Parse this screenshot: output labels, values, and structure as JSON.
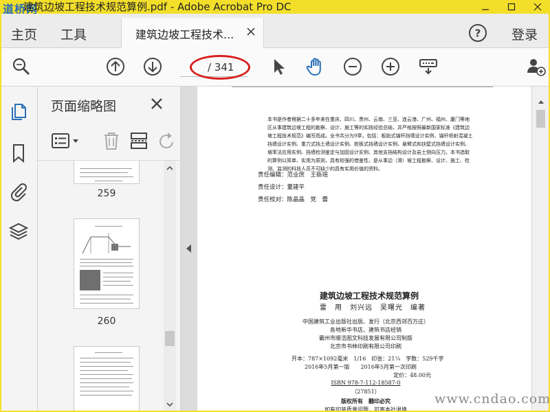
{
  "window": {
    "title": "建筑边坡工程技术规范算例.pdf - Adobe Acrobat Pro DC",
    "logo": "道桥网"
  },
  "nav": {
    "home": "主页",
    "tools": "工具",
    "doc_tab": "建筑边坡工程技术...",
    "login": "登录"
  },
  "toolbar": {
    "page_total": "/ 341"
  },
  "thumbnails_panel": {
    "title": "页面缩略图",
    "pages": [
      {
        "label": "259"
      },
      {
        "label": "260"
      }
    ]
  },
  "document": {
    "intro": "本书是作者根据二十多年来在重庆、四川、贵州、云南、三亚、连云港、广州、福州、厦门等地区从事建筑边坡工程的勘察、设计、施工等的实践经验总结，并严格按照最新国家标准《建筑边坡工程技术规范》编写而成。全书共分为9章，包括：板肋式锚杆挡墙设计实例、锚杆喷射混凝土挡墙设计实例、重力式挡土墙设计实例、桩板式挡墙设计实例、悬臂式和扶壁式挡墙设计实例、坡率法应用实例、挡墙检测鉴定与加固设计实例、其他支挡结构设计及岩土侧向压力。本书选取的算例以简单、实用为原则，具有较强的借鉴性，是从事边（滑）坡工程勘察、设计、施工、检测、监测的科技人员不可缺少的具有实用价值的资料。",
    "credits": [
      "责任编辑：范业庶　王砾瑶",
      "责任设计：董建平",
      "责任校对：陈晶晶　党　蕾"
    ],
    "book_title": "建筑边坡工程技术规范算例",
    "authors": "雷　用　刘兴远　吴曙光　编著",
    "publisher_lines": [
      "中国建筑工业出版社出版、发行（北京西郊百万庄）",
      "各地新华书店、建筑书店经销",
      "霸州市顺浩图文科技发展有限公司制版",
      "北京市书林印刷有限公司印刷"
    ],
    "format": "开本：787×1092毫米　1/16　印张：21¼　字数：529千字",
    "edition": "2016年5月第一版　　2016年5月第一次印刷",
    "price": "定价：48.00元",
    "isbn": "ISBN 978-7-112-18587-0",
    "isbn_sub": "（27851）",
    "rights": "版权所有　翻印必究",
    "notice": "如有印装质量问题，可寄本社退换"
  },
  "watermark": "www.cndao.com",
  "colors": {
    "titlebar": "#f3df2a",
    "accent_blue": "#2a6fb8",
    "highlight_red": "#d81e1e"
  }
}
